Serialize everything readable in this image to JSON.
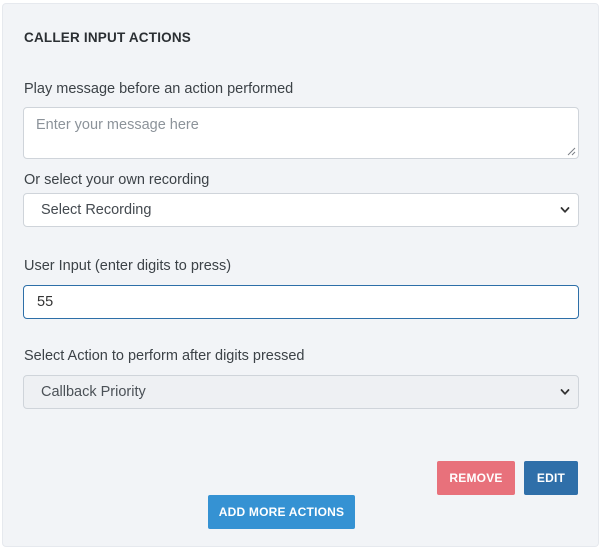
{
  "section": {
    "title": "CALLER INPUT ACTIONS"
  },
  "message": {
    "label": "Play message before an action performed",
    "placeholder": "Enter your message here",
    "value": ""
  },
  "recording": {
    "label": "Or select your own recording",
    "selected": "Select Recording"
  },
  "user_input": {
    "label": "User Input (enter digits to press)",
    "value": "55"
  },
  "action": {
    "label": "Select Action to perform after digits pressed",
    "selected": "Callback Priority"
  },
  "buttons": {
    "remove": "REMOVE",
    "edit": "EDIT",
    "add_more": "ADD MORE ACTIONS"
  },
  "colors": {
    "remove": "#e8717b",
    "edit": "#2f6fa9",
    "add_more": "#3592d3",
    "panel": "#f2f4f7"
  }
}
